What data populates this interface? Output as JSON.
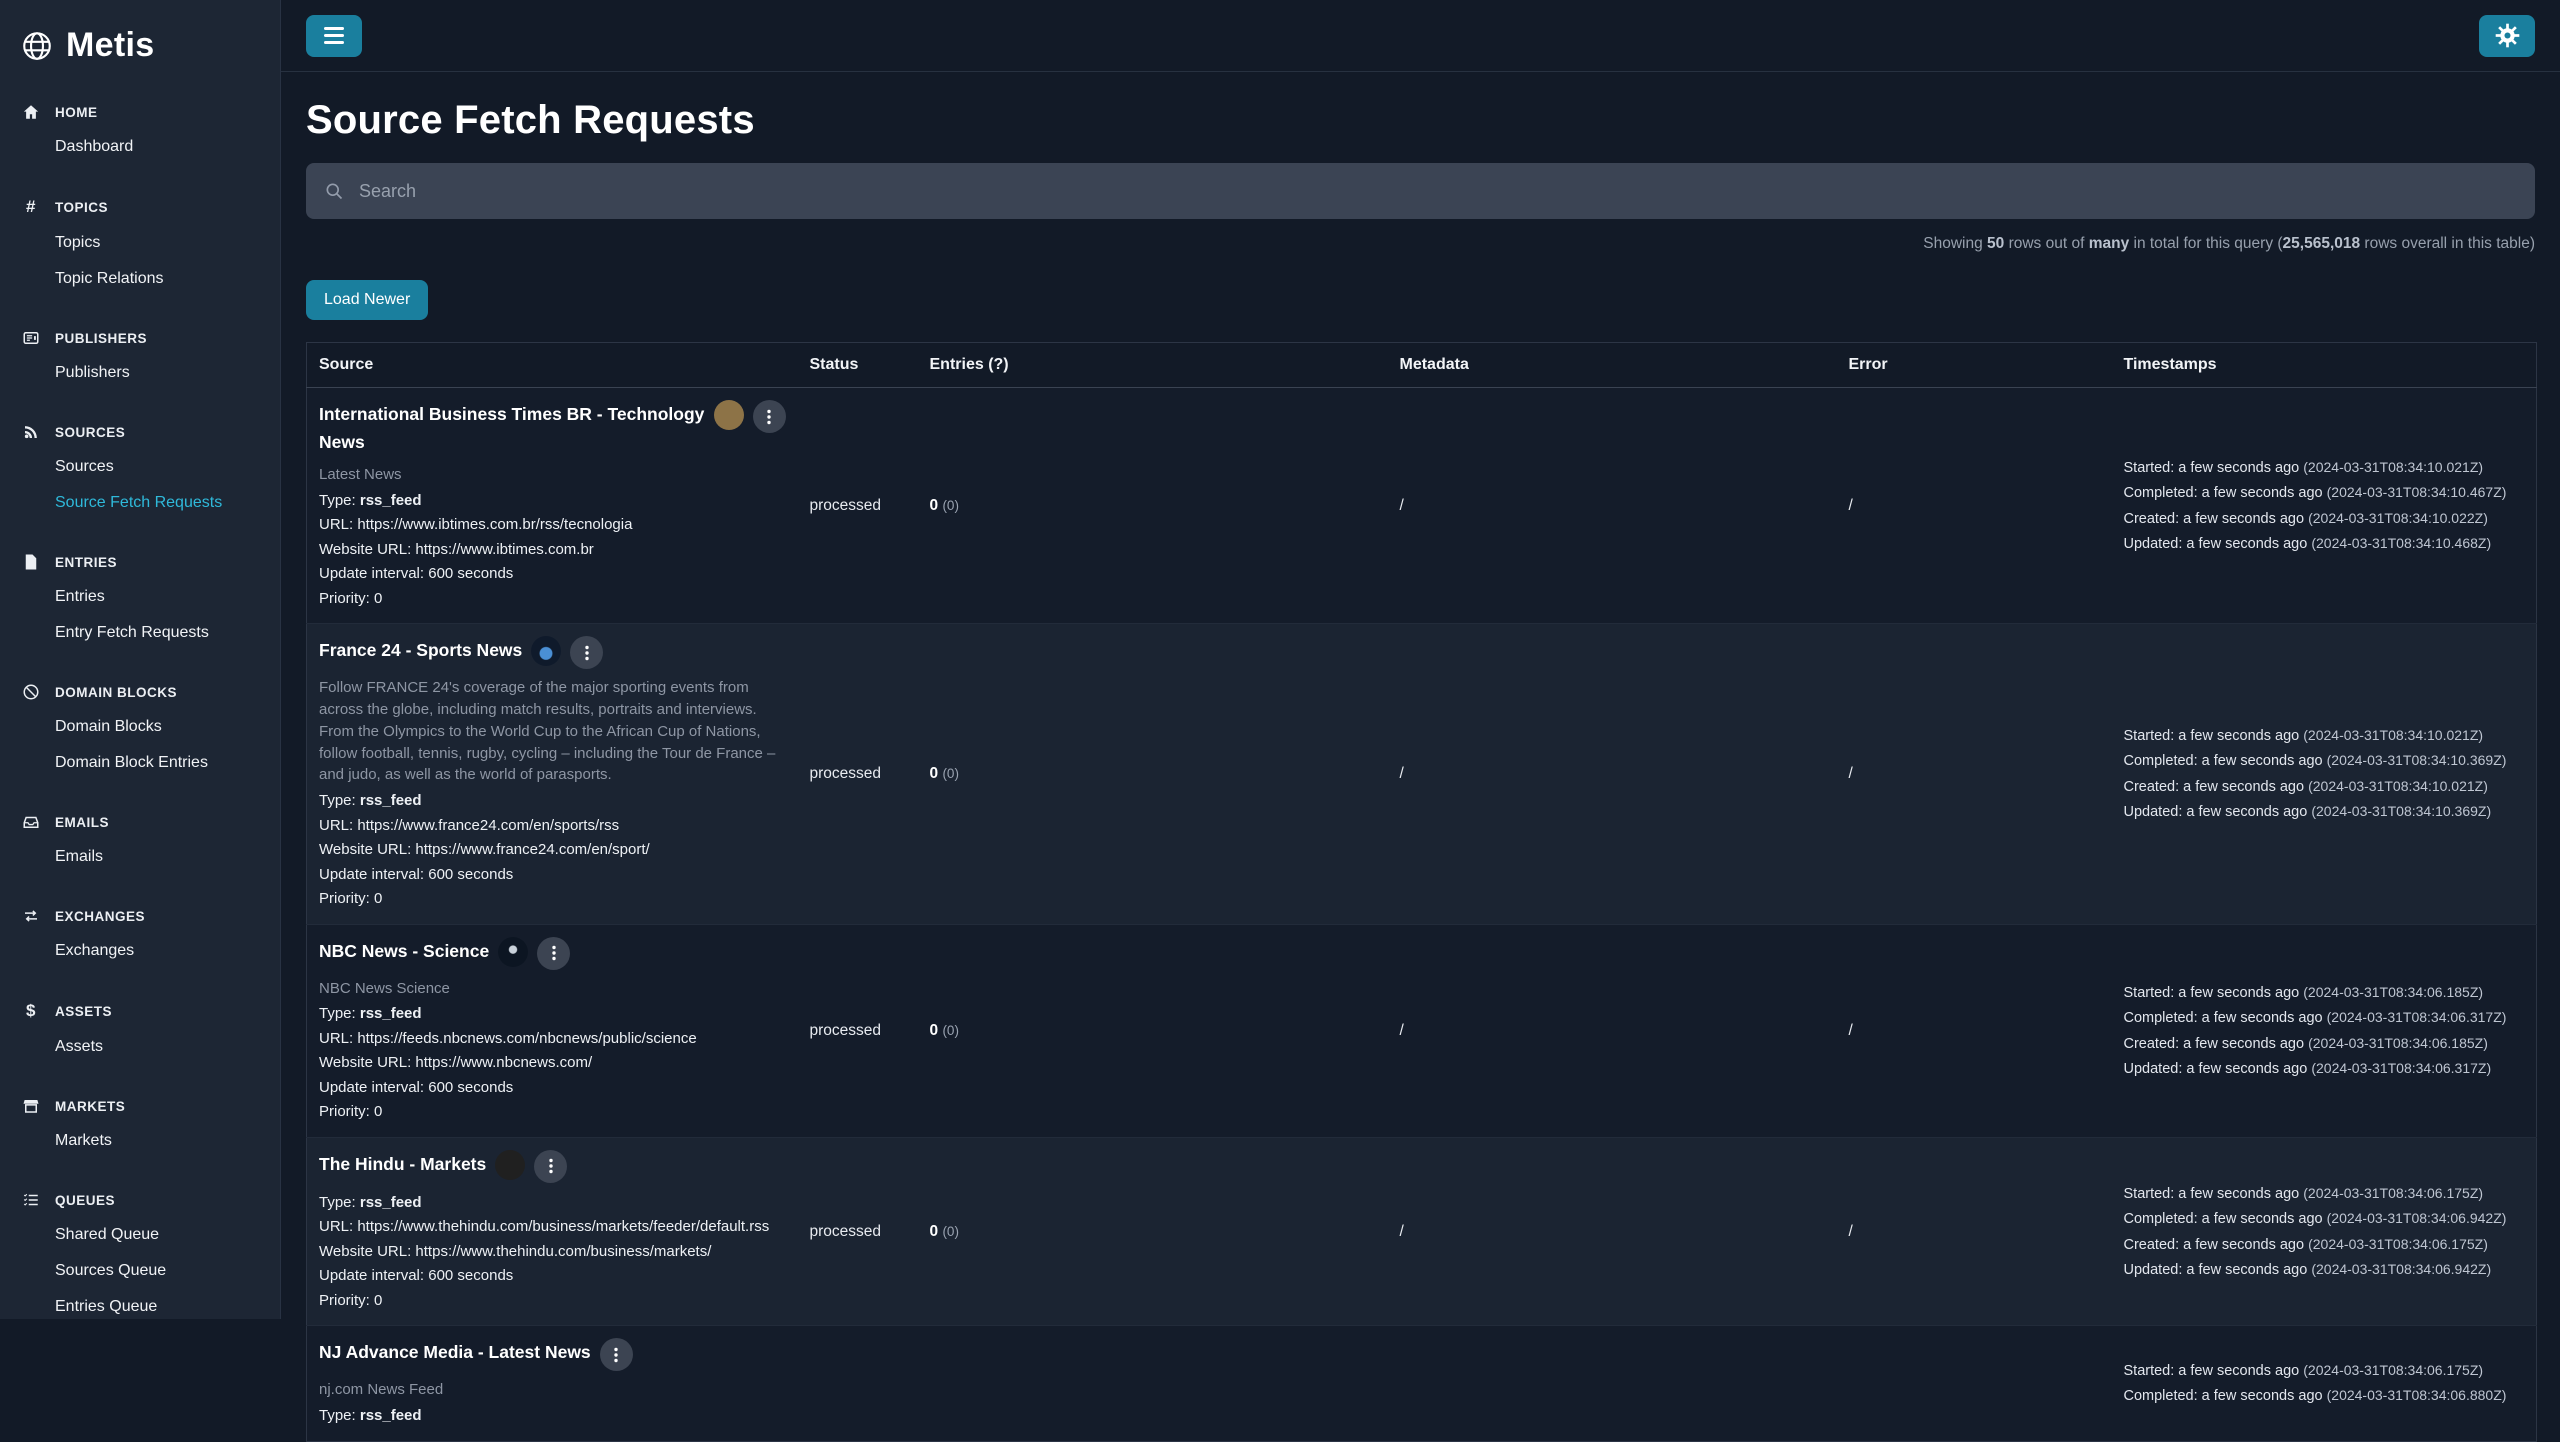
{
  "colors": {
    "accent": "#1a7f9e",
    "sidebar_active_link": "#2fb9da",
    "background": "#121a27",
    "sidebar_background": "#1d2634"
  },
  "brand": {
    "name": "Metis"
  },
  "sidebar": {
    "sections": [
      {
        "label": "HOME",
        "icon": "home-icon",
        "items": [
          {
            "label": "Dashboard"
          }
        ]
      },
      {
        "label": "TOPICS",
        "icon": "hash-icon",
        "items": [
          {
            "label": "Topics"
          },
          {
            "label": "Topic Relations"
          }
        ]
      },
      {
        "label": "PUBLISHERS",
        "icon": "newspaper-icon",
        "items": [
          {
            "label": "Publishers"
          }
        ]
      },
      {
        "label": "SOURCES",
        "icon": "rss-icon",
        "items": [
          {
            "label": "Sources"
          },
          {
            "label": "Source Fetch Requests"
          }
        ]
      },
      {
        "label": "ENTRIES",
        "icon": "document-icon",
        "items": [
          {
            "label": "Entries"
          },
          {
            "label": "Entry Fetch Requests"
          }
        ]
      },
      {
        "label": "DOMAIN BLOCKS",
        "icon": "ban-icon",
        "items": [
          {
            "label": "Domain Blocks"
          },
          {
            "label": "Domain Block Entries"
          }
        ]
      },
      {
        "label": "EMAILS",
        "icon": "inbox-icon",
        "items": [
          {
            "label": "Emails"
          }
        ]
      },
      {
        "label": "EXCHANGES",
        "icon": "exchange-arrows-icon",
        "items": [
          {
            "label": "Exchanges"
          }
        ]
      },
      {
        "label": "ASSETS",
        "icon": "hand-dollar-icon",
        "items": [
          {
            "label": "Assets"
          }
        ]
      },
      {
        "label": "MARKETS",
        "icon": "storefront-icon",
        "items": [
          {
            "label": "Markets"
          }
        ]
      },
      {
        "label": "QUEUES",
        "icon": "task-list-icon",
        "items": [
          {
            "label": "Shared Queue"
          },
          {
            "label": "Sources Queue"
          },
          {
            "label": "Entries Queue"
          }
        ]
      }
    ]
  },
  "page": {
    "title": "Source Fetch Requests"
  },
  "search": {
    "placeholder": "Search"
  },
  "summary": {
    "p1": "Showing ",
    "p2": "50",
    "p3": " rows out of ",
    "p4": "many",
    "p5": " in total for this query (",
    "p6": "25,565,018",
    "p7": " rows overall in this table)"
  },
  "toolbar": {
    "load_newer": "Load Newer"
  },
  "table": {
    "columns": [
      "Source",
      "Status",
      "Entries (?)",
      "Metadata",
      "Error",
      "Timestamps"
    ],
    "rows": [
      {
        "title": "International Business Times BR - Technology News",
        "favicon_style": "background:#8d7347",
        "description": "Latest News",
        "type_label": "Type:",
        "type_value": "rss_feed",
        "url_line": "URL: https://www.ibtimes.com.br/rss/tecnologia",
        "website_line": "Website URL: https://www.ibtimes.com.br",
        "interval_line": "Update interval: 600 seconds",
        "priority_line": "Priority: 0",
        "status": "processed",
        "entries": "0",
        "entries_sub": "(0)",
        "metadata": "/",
        "error": "/",
        "ts": [
          {
            "t": "Started: a few seconds ago",
            "i": "(2024-03-31T08:34:10.021Z)"
          },
          {
            "t": "Completed: a few seconds ago",
            "i": "(2024-03-31T08:34:10.467Z)"
          },
          {
            "t": "Created: a few seconds ago",
            "i": "(2024-03-31T08:34:10.022Z)"
          },
          {
            "t": "Updated: a few seconds ago",
            "i": "(2024-03-31T08:34:10.468Z)"
          }
        ]
      },
      {
        "title": "France 24 - Sports News",
        "favicon_style": "background:radial-gradient(circle at 50% 58%, #4a8fd4 0%, #4a8fd4 26%, #0f1a2b 30%)",
        "description": "Follow FRANCE 24's coverage of the major sporting events from across the globe, including match results, portraits and interviews. From the Olympics to the World Cup to the African Cup of Nations, follow football, tennis, rugby, cycling – including the Tour de France – and judo, as well as the world of parasports.",
        "type_label": "Type:",
        "type_value": "rss_feed",
        "url_line": "URL: https://www.france24.com/en/sports/rss",
        "website_line": "Website URL: https://www.france24.com/en/sport/",
        "interval_line": "Update interval: 600 seconds",
        "priority_line": "Priority: 0",
        "status": "processed",
        "entries": "0",
        "entries_sub": "(0)",
        "metadata": "/",
        "error": "/",
        "ts": [
          {
            "t": "Started: a few seconds ago",
            "i": "(2024-03-31T08:34:10.021Z)"
          },
          {
            "t": "Completed: a few seconds ago",
            "i": "(2024-03-31T08:34:10.369Z)"
          },
          {
            "t": "Created: a few seconds ago",
            "i": "(2024-03-31T08:34:10.021Z)"
          },
          {
            "t": "Updated: a few seconds ago",
            "i": "(2024-03-31T08:34:10.369Z)"
          }
        ]
      },
      {
        "title": "NBC News - Science",
        "favicon_style": "background:radial-gradient(circle at 50% 42%, #c9d1da 0%, #c9d1da 16%, #0c1522 20%)",
        "description": "NBC News Science",
        "type_label": "Type:",
        "type_value": "rss_feed",
        "url_line": "URL: https://feeds.nbcnews.com/nbcnews/public/science",
        "website_line": "Website URL: https://www.nbcnews.com/",
        "interval_line": "Update interval: 600 seconds",
        "priority_line": "Priority: 0",
        "status": "processed",
        "entries": "0",
        "entries_sub": "(0)",
        "metadata": "/",
        "error": "/",
        "ts": [
          {
            "t": "Started: a few seconds ago",
            "i": "(2024-03-31T08:34:06.185Z)"
          },
          {
            "t": "Completed: a few seconds ago",
            "i": "(2024-03-31T08:34:06.317Z)"
          },
          {
            "t": "Created: a few seconds ago",
            "i": "(2024-03-31T08:34:06.185Z)"
          },
          {
            "t": "Updated: a few seconds ago",
            "i": "(2024-03-31T08:34:06.317Z)"
          }
        ]
      },
      {
        "title": "The Hindu - Markets",
        "favicon_style": "background:#202020",
        "description": "",
        "type_label": "Type:",
        "type_value": "rss_feed",
        "url_line": "URL: https://www.thehindu.com/business/markets/feeder/default.rss",
        "website_line": "Website URL: https://www.thehindu.com/business/markets/",
        "interval_line": "Update interval: 600 seconds",
        "priority_line": "Priority: 0",
        "status": "processed",
        "entries": "0",
        "entries_sub": "(0)",
        "metadata": "/",
        "error": "/",
        "ts": [
          {
            "t": "Started: a few seconds ago",
            "i": "(2024-03-31T08:34:06.175Z)"
          },
          {
            "t": "Completed: a few seconds ago",
            "i": "(2024-03-31T08:34:06.942Z)"
          },
          {
            "t": "Created: a few seconds ago",
            "i": "(2024-03-31T08:34:06.175Z)"
          },
          {
            "t": "Updated: a few seconds ago",
            "i": "(2024-03-31T08:34:06.942Z)"
          }
        ]
      },
      {
        "title": "NJ Advance Media - Latest News",
        "description": "nj.com News Feed",
        "type_label": "Type:",
        "type_value": "rss_feed",
        "ts": [
          {
            "t": "Started: a few seconds ago",
            "i": "(2024-03-31T08:34:06.175Z)"
          },
          {
            "t": "Completed: a few seconds ago",
            "i": "(2024-03-31T08:34:06.880Z)"
          }
        ]
      }
    ]
  }
}
